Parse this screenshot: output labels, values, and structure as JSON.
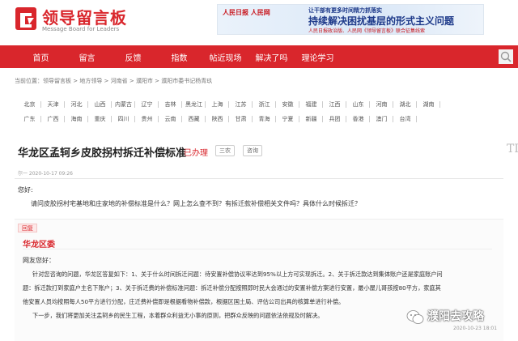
{
  "header": {
    "logo_title": "领导留言板",
    "logo_subtitle": "Message Board for Leaders"
  },
  "banner": {
    "logo": "人民日报 人民网",
    "kicker": "让干部有更多时间精力抓落实",
    "headline": "持续解决困扰基层的形式主义问题",
    "footer": "人民日报政治版、人民网《领导留言板》联合征集线索"
  },
  "nav": {
    "items": [
      "首页",
      "留言",
      "反馈",
      "指数",
      "帖近现场",
      "解决了吗",
      "理论学习"
    ]
  },
  "breadcrumb": "当前位置：领导留言板 > 地方领导 > 河南省 > 濮阳市 > 濮阳市委书记杨青玖",
  "regions": {
    "row1": [
      "北京",
      "天津",
      "河北",
      "山西",
      "内蒙古",
      "辽宁",
      "吉林",
      "黑龙江",
      "上海",
      "江苏",
      "浙江",
      "安徽",
      "福建",
      "江西",
      "山东",
      "河南",
      "湖北",
      "湖南"
    ],
    "row2": [
      "广东",
      "广西",
      "海南",
      "重庆",
      "四川",
      "贵州",
      "云南",
      "西藏",
      "陕西",
      "甘肃",
      "青海",
      "宁夏",
      "新疆",
      "兵团",
      "香港",
      "澳门",
      "台湾"
    ]
  },
  "post": {
    "title": "华龙区孟轲乡皮胶拐村拆迁补偿标准",
    "status": "已办理",
    "tag1": "三农",
    "tag2": "咨询",
    "edge_char": "TI",
    "meta": "尔一    2020-10-17 09:26",
    "greeting": "您好:",
    "question": "请问皮胶拐村宅基地和庄家地的补偿标准是什么？网上怎么查不到？有拆迁款补偿相关文件吗？具体什么时候拆迁？"
  },
  "reply": {
    "tag": "回复",
    "org": "华龙区委",
    "greeting": "网友您好：",
    "lines": [
      "针对您咨询的问题，华龙区答复如下：1、关于什么时间拆迁问题：待安置补偿协议率达到95%以上方可实现拆迁。2、关于拆迁款达到集体账户还是家庭账户问",
      "题：拆迁款打到家庭户主名下账户；3、关于拆迁费的补偿标准问题：拆迁补偿分配按照即时民大会通过的安置补偿方案进行安置，最小屋儿哥孩按80平方，家庭其",
      "他安置人员均按照每人50平方进行分配，庄迁费补偿即是根据看物补偿款，根据区国土局、评估公司出具的核算单进行补偿。",
      "下一步，我们将更加关注孟轲乡的民生工程，本着群众利益无小事的原则，把群众反映的问题依法依规及时解决。"
    ]
  },
  "watermark": {
    "text": "濮阳去攻略",
    "date": "2020-10-23 18:01"
  },
  "colors": {
    "brand_red": "#d9262c",
    "nav_text": "#ffffff"
  }
}
